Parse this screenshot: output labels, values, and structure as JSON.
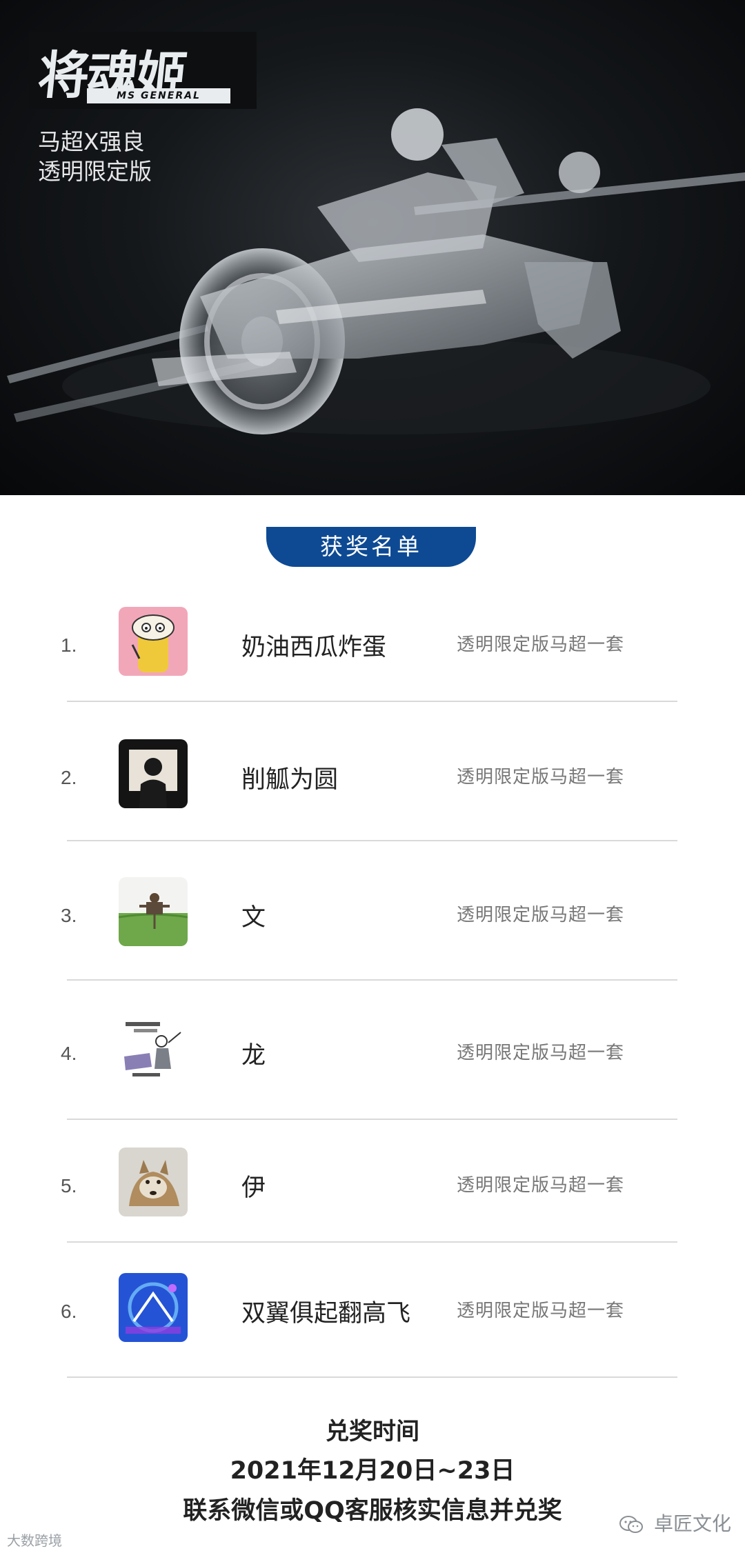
{
  "hero": {
    "logo_text": "将魂姬",
    "logo_sub": "MS GENERAL",
    "subtitle_line1": "马超X强良",
    "subtitle_line2": "透明限定版"
  },
  "winners": {
    "heading": "获奖名单",
    "list": [
      {
        "rank": "1.",
        "name": "奶油西瓜炸蛋",
        "prize": "透明限定版马超一套",
        "avatar": "cartoon-avatar"
      },
      {
        "rank": "2.",
        "name": "削觚为圆",
        "prize": "透明限定版马超一套",
        "avatar": "silhouette-avatar"
      },
      {
        "rank": "3.",
        "name": "文",
        "prize": "透明限定版马超一套",
        "avatar": "scarecrow-field-avatar"
      },
      {
        "rank": "4.",
        "name": "龙",
        "prize": "透明限定版马超一套",
        "avatar": "meme-sticker-avatar"
      },
      {
        "rank": "5.",
        "name": "伊",
        "prize": "透明限定版马超一套",
        "avatar": "coyote-avatar"
      },
      {
        "rank": "6.",
        "name": "双翼俱起翻高飞",
        "prize": "透明限定版马超一套",
        "avatar": "blue-abstract-avatar"
      }
    ]
  },
  "redeem": {
    "title": "兑奖时间",
    "dates": "2021年12月20日~23日",
    "instruction": "联系微信或QQ客服核实信息并兑奖"
  },
  "watermarks": {
    "left": "大数跨境",
    "right": "卓匠文化"
  },
  "colors": {
    "heading_pill": "#0e4a93",
    "divider": "#d9d9d9",
    "hero_bg": "#0d0f11"
  }
}
